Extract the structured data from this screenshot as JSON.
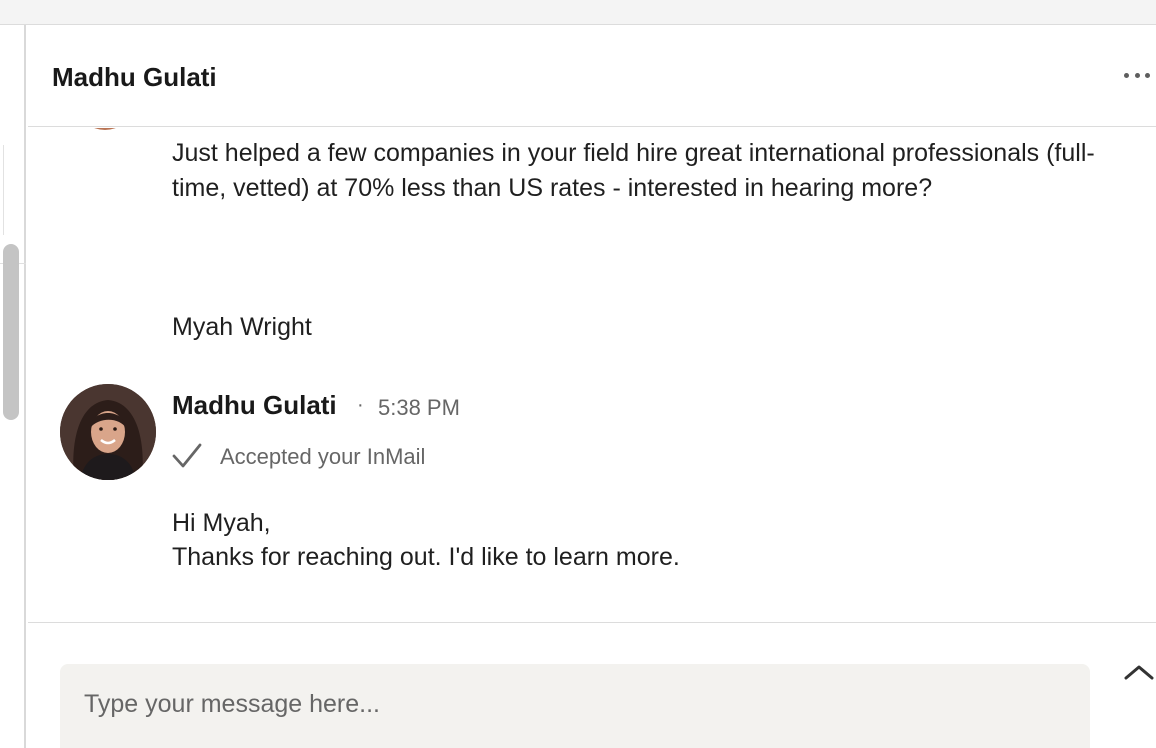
{
  "conversation": {
    "header": {
      "title": "Madhu Gulati",
      "more_icon": "more-horizontal-icon"
    },
    "previous_message": {
      "body": "Just helped a few companies in your field hire great international professionals (full-time, vetted) at 70% less than US rates - interested in hearing more?",
      "signature": "Myah Wright"
    },
    "reply": {
      "sender": "Madhu Gulati",
      "separator": "·",
      "time": "5:38 PM",
      "status_icon": "checkmark-icon",
      "status": "Accepted your InMail",
      "lines": [
        "Hi Myah,",
        "Thanks for reaching out. I'd like to learn more."
      ]
    }
  },
  "composer": {
    "placeholder": "Type your message here...",
    "value": "",
    "expand_icon": "chevron-up-icon"
  },
  "colors": {
    "text_primary": "#191919",
    "text_secondary": "#666666",
    "composer_bg": "#f3f2ef",
    "divider": "#dcdcdc"
  }
}
